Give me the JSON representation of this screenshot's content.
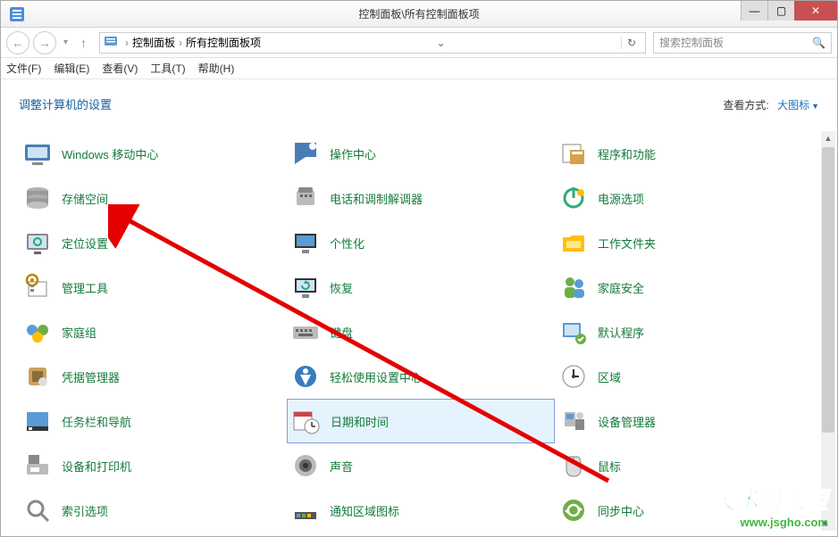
{
  "window": {
    "title": "控制面板\\所有控制面板项",
    "min": "—",
    "max": "▢",
    "close": "✕"
  },
  "nav": {
    "back": "←",
    "forward": "→",
    "dropdown": "▾",
    "up": "↑",
    "crumb_icon": "▣",
    "crumb1": "控制面板",
    "crumb2": "所有控制面板项",
    "sep": "›",
    "go_dd": "⌄",
    "refresh": "↻"
  },
  "search": {
    "placeholder": "搜索控制面板",
    "icon": "🔍"
  },
  "menu": {
    "file": "文件(F)",
    "edit": "编辑(E)",
    "view": "查看(V)",
    "tools": "工具(T)",
    "help": "帮助(H)"
  },
  "header": {
    "heading": "调整计算机的设置",
    "view_label": "查看方式:",
    "view_value": "大图标"
  },
  "columns": [
    {
      "items": [
        {
          "label": "Windows 移动中心",
          "icon": "mobility"
        },
        {
          "label": "存储空间",
          "icon": "storage"
        },
        {
          "label": "定位设置",
          "icon": "location"
        },
        {
          "label": "管理工具",
          "icon": "admin-tools",
          "highlighted": true
        },
        {
          "label": "家庭组",
          "icon": "homegroup"
        },
        {
          "label": "凭据管理器",
          "icon": "credentials"
        },
        {
          "label": "任务栏和导航",
          "icon": "taskbar"
        },
        {
          "label": "设备和打印机",
          "icon": "devices-printers"
        },
        {
          "label": "索引选项",
          "icon": "indexing"
        }
      ]
    },
    {
      "items": [
        {
          "label": "操作中心",
          "icon": "action-center"
        },
        {
          "label": "电话和调制解调器",
          "icon": "phone-modem"
        },
        {
          "label": "个性化",
          "icon": "personalization"
        },
        {
          "label": "恢复",
          "icon": "recovery"
        },
        {
          "label": "键盘",
          "icon": "keyboard"
        },
        {
          "label": "轻松使用设置中心",
          "icon": "ease-of-access"
        },
        {
          "label": "日期和时间",
          "icon": "date-time",
          "selected": true
        },
        {
          "label": "声音",
          "icon": "sound"
        },
        {
          "label": "通知区域图标",
          "icon": "notification-area"
        }
      ]
    },
    {
      "items": [
        {
          "label": "程序和功能",
          "icon": "programs"
        },
        {
          "label": "电源选项",
          "icon": "power"
        },
        {
          "label": "工作文件夹",
          "icon": "work-folders"
        },
        {
          "label": "家庭安全",
          "icon": "family-safety"
        },
        {
          "label": "默认程序",
          "icon": "default-programs"
        },
        {
          "label": "区域",
          "icon": "region"
        },
        {
          "label": "设备管理器",
          "icon": "device-manager"
        },
        {
          "label": "鼠标",
          "icon": "mouse"
        },
        {
          "label": "同步中心",
          "icon": "sync-center"
        }
      ]
    }
  ],
  "watermark": {
    "line1": "技术员联盟",
    "line2": "www.jsgho.com"
  }
}
